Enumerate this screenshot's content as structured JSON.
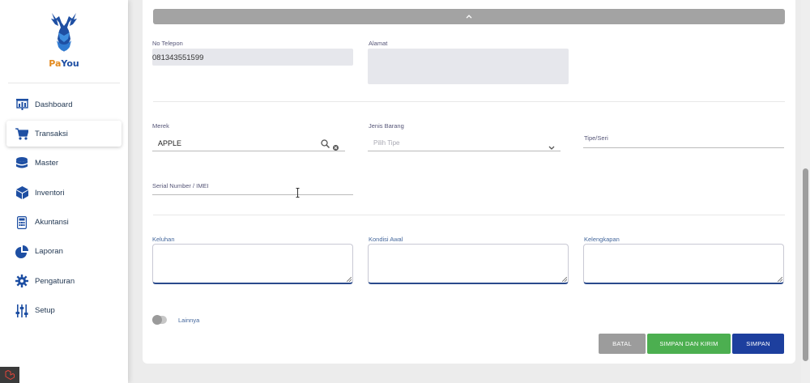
{
  "brand": {
    "name_pa": "Pa",
    "name_you": "You"
  },
  "sidebar": {
    "items": [
      {
        "label": "Dashboard",
        "icon": "dashboard-icon"
      },
      {
        "label": "Transaksi",
        "icon": "cart-icon",
        "active": true
      },
      {
        "label": "Master",
        "icon": "database-icon"
      },
      {
        "label": "Inventori",
        "icon": "box-icon"
      },
      {
        "label": "Akuntansi",
        "icon": "calculator-icon"
      },
      {
        "label": "Laporan",
        "icon": "pie-chart-icon"
      },
      {
        "label": "Pengaturan",
        "icon": "gear-icon"
      },
      {
        "label": "Setup",
        "icon": "sliders-icon"
      }
    ]
  },
  "form": {
    "collapse_icon": "chevron-up-icon",
    "no_telepon": {
      "label": "No Telepon",
      "value": "081343551599"
    },
    "alamat": {
      "label": "Alamat",
      "value": ""
    },
    "merek": {
      "label": "Merek",
      "value": "APPLE"
    },
    "jenis_barang": {
      "label": "Jenis Barang",
      "placeholder": "Pilih Tipe"
    },
    "tipe_seri": {
      "label": "Tipe/Seri",
      "value": ""
    },
    "serial_number": {
      "label": "Serial Number / IMEI",
      "value": ""
    },
    "keluhan": {
      "label": "Keluhan"
    },
    "kondisi_awal": {
      "label": "Kondisi Awal"
    },
    "kelengkapan": {
      "label": "Kelengkapan"
    },
    "lainnya": {
      "label": "Lainnya",
      "checked": false
    }
  },
  "actions": {
    "batal": "BATAL",
    "simpan_kirim": "SIMPAN DAN KIRIM",
    "simpan": "SIMPAN"
  },
  "colors": {
    "primary": "#1d3f9e",
    "success": "#4caf50",
    "muted": "#9c9c9c",
    "brand_orange": "#e38a1e"
  }
}
